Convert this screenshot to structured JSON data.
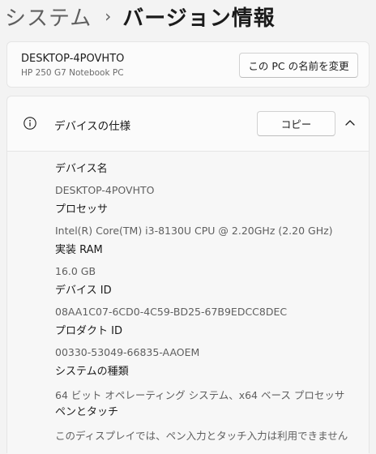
{
  "breadcrumb": {
    "parent": "システム",
    "separator": "›",
    "current": "バージョン情報"
  },
  "device": {
    "name": "DESKTOP-4POVHTO",
    "model": "HP 250 G7 Notebook PC",
    "rename_button": "この PC の名前を変更"
  },
  "device_specs": {
    "title": "デバイスの仕様",
    "copy_button": "コピー",
    "items": [
      {
        "label": "デバイス名",
        "value": "DESKTOP-4POVHTO"
      },
      {
        "label": "プロセッサ",
        "value": "Intel(R) Core(TM) i3-8130U CPU @ 2.20GHz (2.20 GHz)"
      },
      {
        "label": "実装 RAM",
        "value": "16.0 GB"
      },
      {
        "label": "デバイス ID",
        "value": "08AA1C07-6CD0-4C59-BD25-67B9EDCC8DEC"
      },
      {
        "label": "プロダクト ID",
        "value": "00330-53049-66835-AAOEM"
      },
      {
        "label": "システムの種類",
        "value": "64 ビット オペレーティング システム、x64 ベース プロセッサ"
      },
      {
        "label": "ペンとタッチ",
        "value": "このディスプレイでは、ペン入力とタッチ入力は利用できません"
      }
    ]
  },
  "icons": {
    "info": "info-circle-icon",
    "collapse": "chevron-up-icon"
  },
  "colors": {
    "background": "#f3f3f3",
    "card": "#fbfbfb",
    "secondary_text": "#5f5f5f"
  }
}
